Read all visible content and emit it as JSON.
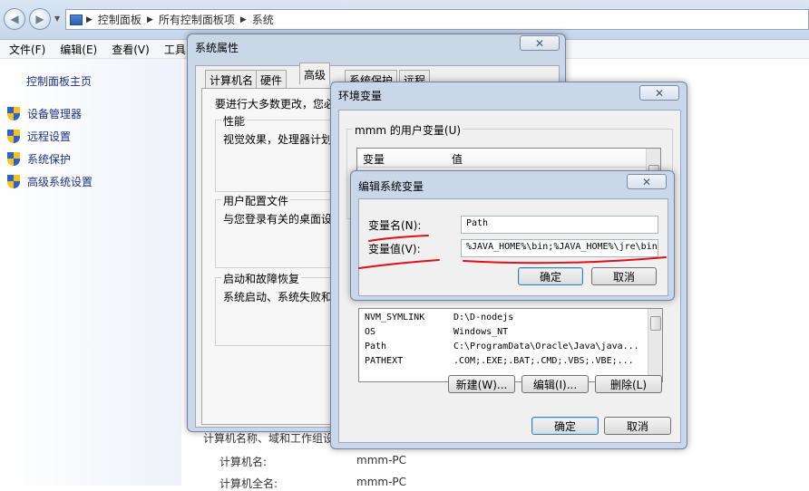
{
  "explorer": {
    "breadcrumbs": [
      "控制面板",
      "所有控制面板项",
      "系统"
    ],
    "menu": [
      "文件(F)",
      "编辑(E)",
      "查看(V)",
      "工具"
    ],
    "left_title": "控制面板主页",
    "left_links": [
      "设备管理器",
      "远程设置",
      "系统保护",
      "高级系统设置"
    ],
    "bg_group_partial": "计算机名称、域和工作组设",
    "computer_name_label": "计算机名:",
    "computer_name_value": "mmm-PC",
    "full_name_label": "计算机全名:",
    "full_name_value": "mmm-PC"
  },
  "sysprops": {
    "title": "系统属性",
    "tabs": [
      "计算机名",
      "硬件",
      "高级",
      "系统保护",
      "远程"
    ],
    "active_tab": "高级",
    "admin_note": "要进行大多数更改，您必",
    "perf_group": "性能",
    "perf_desc": "视觉效果，处理器计划",
    "profile_group": "用户配置文件",
    "profile_desc": "与您登录有关的桌面设",
    "startup_group": "启动和故障恢复",
    "startup_desc": "系统启动、系统失败和"
  },
  "envvars": {
    "title": "环境变量",
    "user_group": "mmm 的用户变量(U)",
    "col_var": "变量",
    "col_val": "值",
    "sys_rows": [
      {
        "name": "NVM_SYMLINK",
        "value": "D:\\D-nodejs"
      },
      {
        "name": "OS",
        "value": "Windows_NT"
      },
      {
        "name": "Path",
        "value": "C:\\ProgramData\\Oracle\\Java\\java..."
      },
      {
        "name": "PATHEXT",
        "value": ".COM;.EXE;.BAT;.CMD;.VBS;.VBE;..."
      }
    ],
    "btn_new": "新建(W)...",
    "btn_edit": "编辑(I)...",
    "btn_delete": "删除(L)",
    "btn_ok": "确定",
    "btn_cancel": "取消"
  },
  "editvar": {
    "title": "编辑系统变量",
    "name_label": "变量名(N):",
    "name_value": "Path",
    "value_label": "变量值(V):",
    "value_value": "%JAVA_HOME%\\bin;%JAVA_HOME%\\jre\\bin",
    "btn_ok": "确定",
    "btn_cancel": "取消"
  },
  "accent": {
    "annotation_red": "#e0101b",
    "link_blue": "#1e3287"
  }
}
